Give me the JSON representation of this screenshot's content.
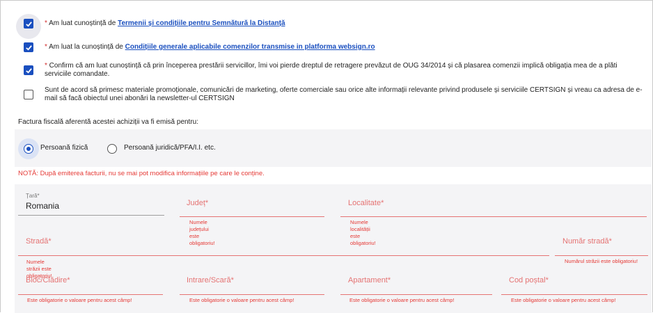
{
  "consents": [
    {
      "star": "* ",
      "text": "Am luat cunoștință  de ",
      "link": "Termenii și condițiile pentru Semnătură la Distanță",
      "checked": true
    },
    {
      "star": "* ",
      "text": "Am luat la cunoștință  de ",
      "link": "Condițiile generale aplicabile comenzilor transmise in platforma websign.ro",
      "checked": true
    },
    {
      "star": "* ",
      "text": "Confirm că am luat cunoștință că prin începerea prestării servicillor,  îmi voi pierde dreptul de retragere prevăzut de OUG 34/2014 și că plasarea comenzii implică obligația mea de a plăti serviciile comandate.",
      "checked": true
    },
    {
      "star": "",
      "text": "Sunt de acord să primesc materiale promoționale, comunicări de marketing, oferte comerciale sau orice alte informații relevante privind produsele și serviciile CERTSIGN și vreau ca adresa de e-mail să facă obiectul unei abonări la newsletter-ul CERTSIGN",
      "checked": false
    }
  ],
  "invoice_label": "Factura fiscală aferentă acestei achiziții va fi emisă pentru:",
  "radios": [
    {
      "label": "Persoană fizică",
      "selected": true
    },
    {
      "label": "Persoană juridică/PFA/I.I. etc.",
      "selected": false
    }
  ],
  "nota": "NOTĂ: După emiterea facturii, nu se mai pot modifica informațiile pe care le conține.",
  "address": {
    "tara_label": "Țară*",
    "tara_value": "Romania",
    "judet_label": "Județ*",
    "judet_error": "Numele județului este obligatoriu!",
    "localitate_label": "Localitate*",
    "localitate_error": "Numele localității este obligatoriu!",
    "strada_label": "Stradă*",
    "strada_error": "Numele străzii este obligatoriu!",
    "numar_label": "Număr stradă*",
    "numar_error": "Numărul străzii este obligatoriu!",
    "bloc_label": "Bloc/Clădire*",
    "intrare_label": "Intrare/Scară*",
    "apartament_label": "Apartament*",
    "cod_label": "Cod poștal*",
    "generic_error": "Este obligatorie o valoare pentru acest câmp!"
  },
  "colors": {
    "accent": "#1a4fbf",
    "error": "#e53935",
    "label": "#e57373"
  }
}
